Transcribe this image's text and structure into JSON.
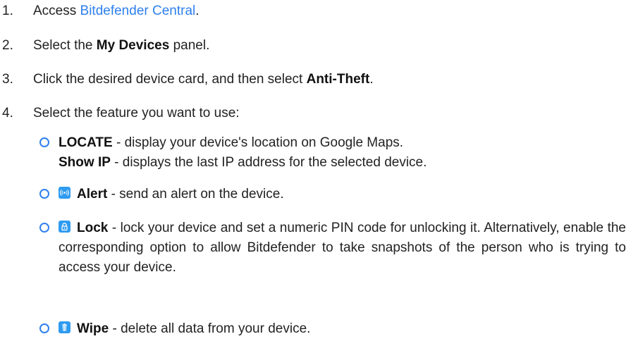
{
  "steps": [
    {
      "num": "1.",
      "pre": "Access ",
      "link": "Bitdefender Central",
      "post": "."
    },
    {
      "num": "2.",
      "pre": "Select the ",
      "bold": "My Devices",
      "post": " panel."
    },
    {
      "num": "3.",
      "pre": "Click the desired device card, and then select ",
      "bold": "Anti-Theft",
      "post": "."
    },
    {
      "num": "4.",
      "text": "Select the feature you want to use:"
    }
  ],
  "features": [
    {
      "bold": "LOCATE",
      "text": " - display your device's location on Google Maps.",
      "extra_bold": "Show IP",
      "extra_text": " - displays the last IP address for the selected device."
    },
    {
      "icon": "alert-icon",
      "bold": "Alert",
      "text": " - send an alert on the device."
    },
    {
      "icon": "lock-icon",
      "bold": "Lock",
      "text": " - lock your device and set a numeric PIN code for unlocking it. Alternatively, enable the corresponding option to allow Bitdefender to take snapshots of the person who is trying to access your device."
    },
    {
      "icon": "trash-icon",
      "bold": "Wipe",
      "text": " - delete all data from your device."
    }
  ],
  "colors": {
    "accent": "#2f80ed",
    "icon_bg": "#2f9bf0",
    "text": "#222222"
  }
}
